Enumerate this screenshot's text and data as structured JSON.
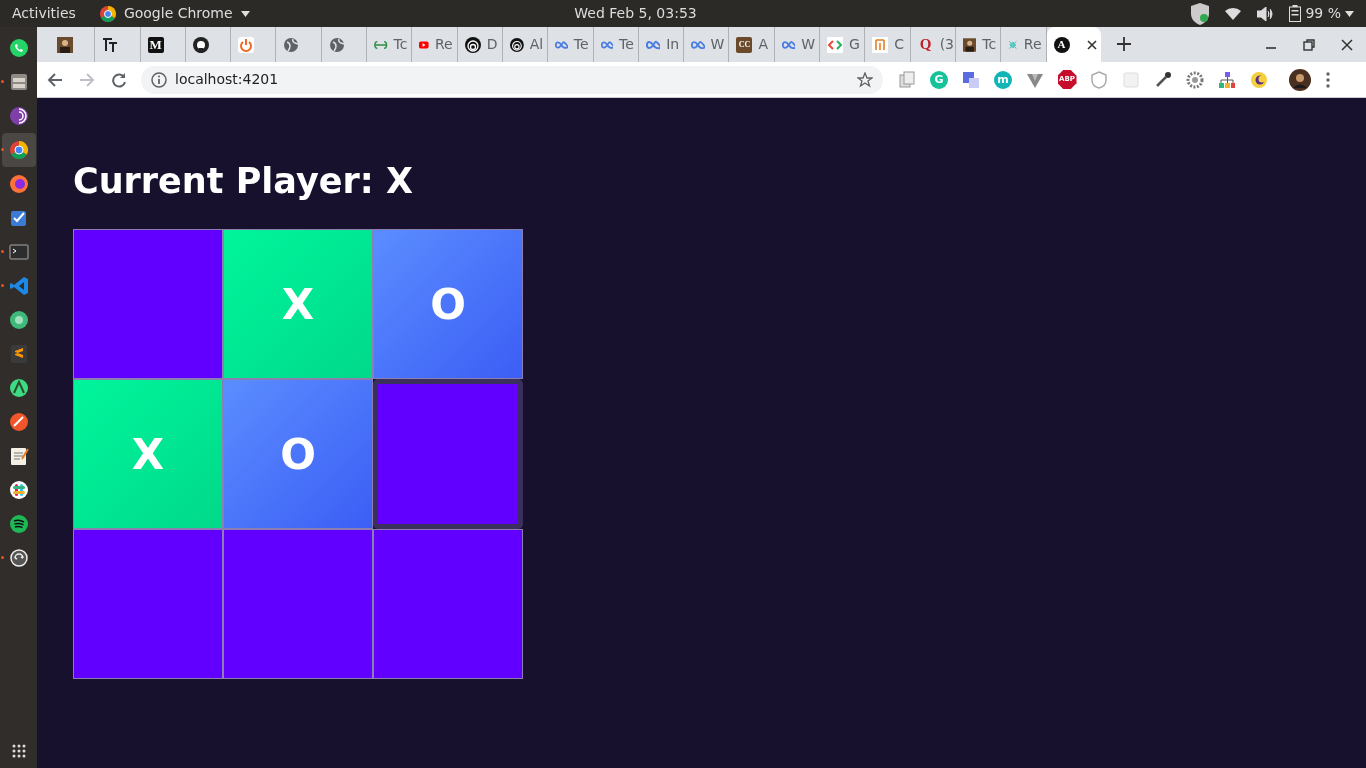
{
  "top_bar": {
    "activities": "Activities",
    "app_name": "Google Chrome",
    "clock": "Wed Feb  5, 03:53",
    "battery": "99 %"
  },
  "dock": [
    {
      "kind": "whatsapp",
      "running": false,
      "selected": false
    },
    {
      "kind": "files",
      "running": true,
      "selected": false
    },
    {
      "kind": "tor",
      "running": false,
      "selected": false
    },
    {
      "kind": "chrome",
      "running": true,
      "selected": true
    },
    {
      "kind": "firefox",
      "running": false,
      "selected": false
    },
    {
      "kind": "tasks",
      "running": false,
      "selected": false
    },
    {
      "kind": "terminal",
      "running": true,
      "selected": false
    },
    {
      "kind": "vscode",
      "running": true,
      "selected": false
    },
    {
      "kind": "green",
      "running": false,
      "selected": false
    },
    {
      "kind": "sublime",
      "running": false,
      "selected": false
    },
    {
      "kind": "android",
      "running": false,
      "selected": false
    },
    {
      "kind": "orange",
      "running": false,
      "selected": false
    },
    {
      "kind": "editor",
      "running": false,
      "selected": false
    },
    {
      "kind": "slack",
      "running": false,
      "selected": false
    },
    {
      "kind": "spotify",
      "running": false,
      "selected": false
    },
    {
      "kind": "updater",
      "running": true,
      "selected": false
    }
  ],
  "tabs": [
    {
      "kind": "photo",
      "selected": false
    },
    {
      "kind": "type",
      "selected": false
    },
    {
      "kind": "letter",
      "icon_text": "M",
      "selected": false
    },
    {
      "kind": "github",
      "selected": false
    },
    {
      "kind": "power",
      "selected": false
    },
    {
      "kind": "globe",
      "selected": false
    },
    {
      "kind": "globe",
      "selected": false
    },
    {
      "kind": "gfg",
      "title": "Tc",
      "selected": false
    },
    {
      "kind": "youtube",
      "title": "Re",
      "selected": false
    },
    {
      "kind": "spiral",
      "title": "D",
      "selected": false
    },
    {
      "kind": "spiral",
      "title": "Al",
      "selected": false
    },
    {
      "kind": "infinity",
      "title": "Te",
      "selected": false
    },
    {
      "kind": "infinity",
      "title": "Te",
      "selected": false
    },
    {
      "kind": "infinity",
      "title": "In",
      "selected": false
    },
    {
      "kind": "infinity",
      "title": "W",
      "selected": false
    },
    {
      "kind": "brown",
      "icon_text": "CC",
      "title": "A",
      "selected": false
    },
    {
      "kind": "infinity",
      "title": "W",
      "selected": false
    },
    {
      "kind": "code",
      "title": "G",
      "selected": false
    },
    {
      "kind": "bracket",
      "title": "C",
      "selected": false
    },
    {
      "kind": "redletter",
      "icon_text": "Q",
      "title": "(3",
      "selected": false
    },
    {
      "kind": "photo",
      "title": "Tc",
      "selected": false
    },
    {
      "kind": "arrows",
      "title": "Re",
      "selected": false
    },
    {
      "kind": "shield",
      "icon_text": "A",
      "selected": true
    }
  ],
  "address_bar": {
    "url": "localhost:4201"
  },
  "extensions": [
    {
      "kind": "copy"
    },
    {
      "kind": "circle",
      "color": "#15c39a",
      "label": "G"
    },
    {
      "kind": "translate"
    },
    {
      "kind": "circle",
      "color": "#12b5b5",
      "label": "m"
    },
    {
      "kind": "vee"
    },
    {
      "kind": "octagon",
      "label": "ABP"
    },
    {
      "kind": "shield"
    },
    {
      "kind": "blank"
    },
    {
      "kind": "dropper"
    },
    {
      "kind": "gear"
    },
    {
      "kind": "tree"
    },
    {
      "kind": "moon"
    }
  ],
  "game": {
    "title": "Current Player: X",
    "cells": [
      {
        "kind": "empty",
        "hovered": false
      },
      {
        "kind": "x",
        "mark": "X",
        "hovered": false
      },
      {
        "kind": "o",
        "mark": "O",
        "hovered": false
      },
      {
        "kind": "x",
        "mark": "X",
        "hovered": false
      },
      {
        "kind": "o",
        "mark": "O",
        "hovered": false
      },
      {
        "kind": "empty",
        "hovered": true
      },
      {
        "kind": "empty",
        "hovered": false
      },
      {
        "kind": "empty",
        "hovered": false
      },
      {
        "kind": "empty",
        "hovered": false
      }
    ]
  }
}
